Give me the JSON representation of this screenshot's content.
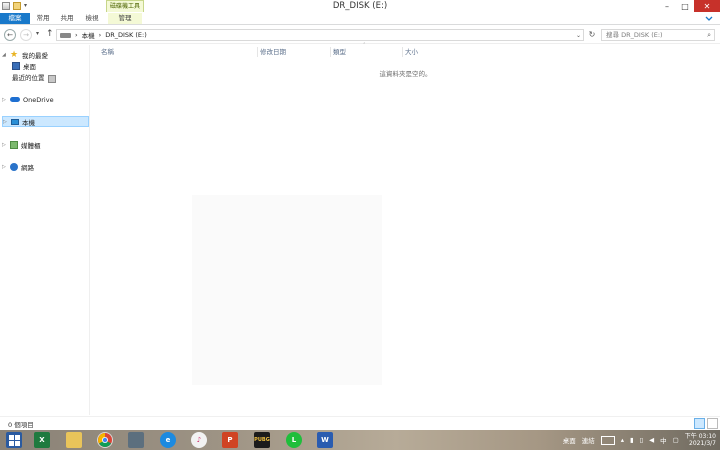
{
  "window": {
    "title": "DR_DISK (E:)",
    "context_tab_group": "磁碟機工具",
    "minimize": "–",
    "maximize": "□",
    "close": "✕"
  },
  "ribbon": {
    "tabs": [
      "檔案",
      "常用",
      "共用",
      "檢視",
      "管理"
    ],
    "expand_icon": "chevron-down"
  },
  "address_bar": {
    "back": "←",
    "forward": "→",
    "up": "↑",
    "path": [
      "本機",
      "DR_DISK (E:)"
    ],
    "separator": "›",
    "refresh": "↻",
    "search_placeholder": "搜尋 DR_DISK (E:)"
  },
  "nav_pane": {
    "items": [
      {
        "label": "我的最愛",
        "icon": "star-icon"
      },
      {
        "label": "桌面",
        "icon": "desktop-icon"
      },
      {
        "label": "最近的位置",
        "icon": "recent-places-icon"
      },
      {
        "label": "OneDrive",
        "icon": "onedrive-icon"
      },
      {
        "label": "本機",
        "icon": "this-pc-icon",
        "selected": true
      },
      {
        "label": "媒體櫃",
        "icon": "libraries-icon"
      },
      {
        "label": "網路",
        "icon": "network-icon"
      }
    ]
  },
  "content": {
    "columns": [
      "名稱",
      "修改日期",
      "類型",
      "大小"
    ],
    "empty_message": "這資料夾是空的。"
  },
  "status_bar": {
    "item_count": "0 個項目"
  },
  "taskbar": {
    "apps": [
      "start",
      "excel",
      "file-explorer",
      "chrome",
      "media",
      "internet-explorer",
      "itunes",
      "powerpoint",
      "pubg",
      "line",
      "word"
    ],
    "tray": {
      "desktop_label": "桌面",
      "links_label": "連結",
      "ime": "中",
      "time": "下午 03:10",
      "date": "2021/3/7"
    }
  }
}
